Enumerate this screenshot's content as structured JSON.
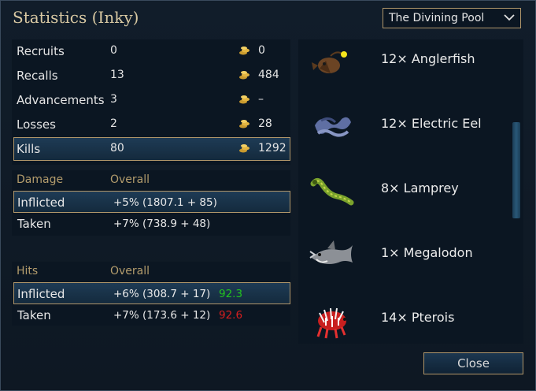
{
  "title": "Statistics (Inky)",
  "dropdown": {
    "selected": "The Divining Pool"
  },
  "stats": [
    {
      "label": "Recruits",
      "value": "0",
      "gold": "0"
    },
    {
      "label": "Recalls",
      "value": "13",
      "gold": "484"
    },
    {
      "label": "Advancements",
      "value": "3",
      "gold": "–"
    },
    {
      "label": "Losses",
      "value": "2",
      "gold": "28"
    },
    {
      "label": "Kills",
      "value": "80",
      "gold": "1292"
    }
  ],
  "damage": {
    "header": "Damage",
    "overall_header": "Overall",
    "inflicted": {
      "label": "Inflicted",
      "value": "+5% (1807.1 + 85)"
    },
    "taken": {
      "label": "Taken",
      "value": "+7% (738.9 + 48)"
    }
  },
  "hits": {
    "header": "Hits",
    "overall_header": "Overall",
    "inflicted": {
      "label": "Inflicted",
      "value": "+6% (308.7 + 17)",
      "pct": "92.3"
    },
    "taken": {
      "label": "Taken",
      "value": "+7% (173.6 + 12)",
      "pct": "92.6"
    }
  },
  "units": [
    {
      "name": "12× Anglerfish",
      "icon": "anglerfish-icon"
    },
    {
      "name": "12× Electric Eel",
      "icon": "electric-eel-icon"
    },
    {
      "name": "8× Lamprey",
      "icon": "lamprey-icon"
    },
    {
      "name": "1× Megalodon",
      "icon": "megalodon-icon"
    },
    {
      "name": "14× Pterois",
      "icon": "pterois-icon"
    }
  ],
  "close_label": "Close",
  "colors": {
    "gold_text": "#b39c6c",
    "highlight_border": "#b0966a",
    "pct_good": "#22c41e",
    "pct_bad": "#d61f1f"
  }
}
